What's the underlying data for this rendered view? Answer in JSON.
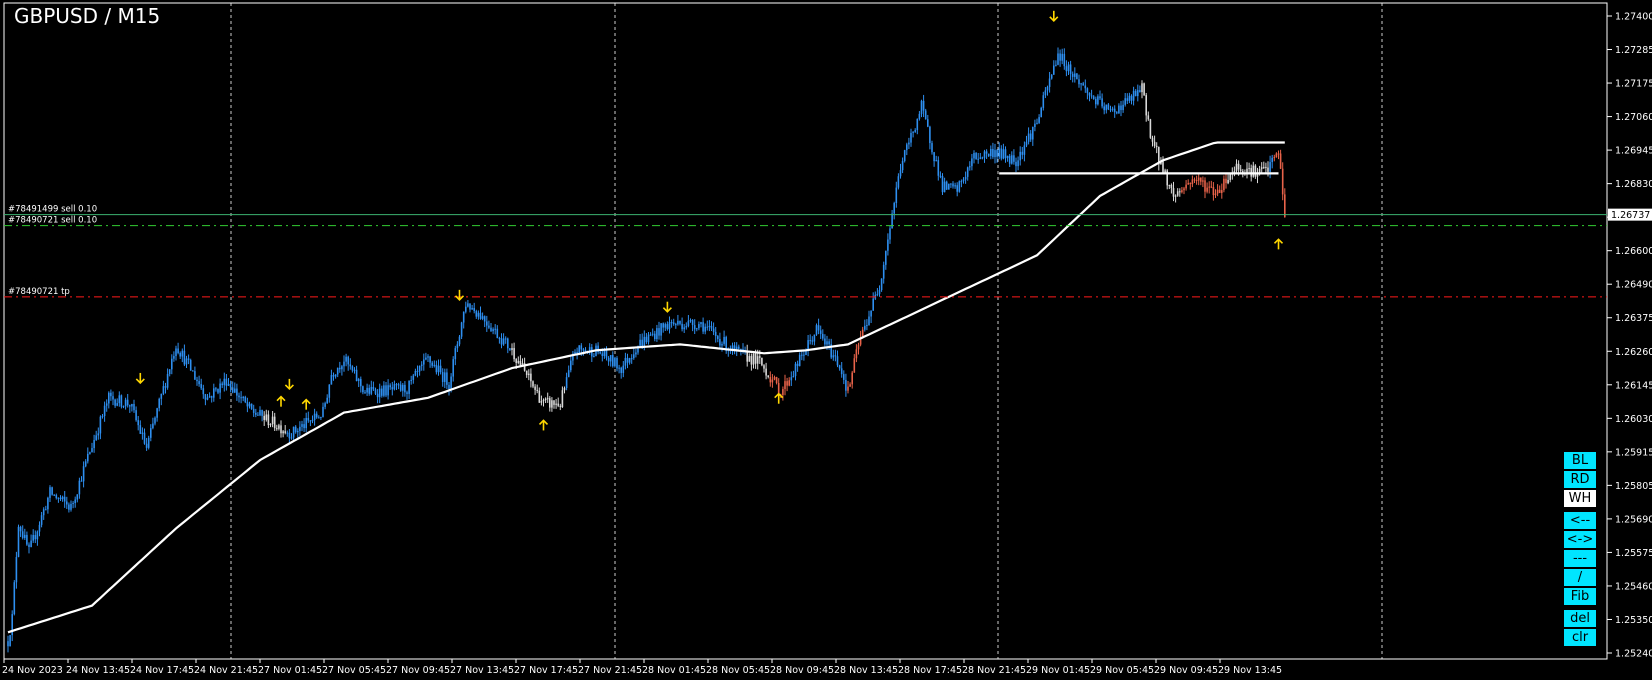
{
  "title": "GBPUSD / M15",
  "buttons": [
    {
      "label": "BL",
      "style": "cyan",
      "gap": false
    },
    {
      "label": "RD",
      "style": "cyan",
      "gap": false
    },
    {
      "label": "WH",
      "style": "white",
      "gap": false
    },
    {
      "label": "<--",
      "style": "cyan",
      "gap": true
    },
    {
      "label": "<->",
      "style": "cyan",
      "gap": false
    },
    {
      "label": "---",
      "style": "cyan",
      "gap": false
    },
    {
      "label": "/",
      "style": "cyan",
      "gap": false
    },
    {
      "label": "Fib",
      "style": "cyan",
      "gap": false
    },
    {
      "label": "del",
      "style": "cyan",
      "gap": true
    },
    {
      "label": "clr",
      "style": "cyan",
      "gap": false
    }
  ],
  "chart_data": {
    "type": "candlestick",
    "symbol": "GBPUSD",
    "timeframe": "M15",
    "ylim": [
      1.2524,
      1.2745
    ],
    "y_ticks": [
      "1.27400",
      "1.27285",
      "1.27175",
      "1.27060",
      "1.26945",
      "1.26830",
      "1.26715",
      "1.26600",
      "1.26490",
      "1.26375",
      "1.26260",
      "1.26145",
      "1.26030",
      "1.25915",
      "1.25805",
      "1.25690",
      "1.25575",
      "1.25460",
      "1.25350",
      "1.25240"
    ],
    "x_ticks": [
      "24 Nov 2023",
      "24 Nov 13:45",
      "24 Nov 17:45",
      "24 Nov 21:45",
      "27 Nov 01:45",
      "27 Nov 05:45",
      "27 Nov 09:45",
      "27 Nov 13:45",
      "27 Nov 17:45",
      "27 Nov 21:45",
      "28 Nov 01:45",
      "28 Nov 05:45",
      "28 Nov 09:45",
      "28 Nov 13:45",
      "28 Nov 17:45",
      "28 Nov 21:45",
      "29 Nov 01:45",
      "29 Nov 05:45",
      "29 Nov 09:45",
      "29 Nov 13:45"
    ],
    "grid": "vertical-dotted",
    "current_price": "1.26737",
    "price_key_points": [
      [
        0,
        1.253
      ],
      [
        2,
        1.2538
      ],
      [
        5,
        1.257
      ],
      [
        10,
        1.256
      ],
      [
        20,
        1.258
      ],
      [
        30,
        1.2575
      ],
      [
        38,
        1.2592
      ],
      [
        48,
        1.2612
      ],
      [
        58,
        1.261
      ],
      [
        66,
        1.2595
      ],
      [
        80,
        1.263
      ],
      [
        95,
        1.2612
      ],
      [
        104,
        1.2618
      ],
      [
        115,
        1.2608
      ],
      [
        135,
        1.26
      ],
      [
        150,
        1.2607
      ],
      [
        154,
        1.262
      ],
      [
        160,
        1.2625
      ],
      [
        170,
        1.2614
      ],
      [
        190,
        1.2615
      ],
      [
        200,
        1.2625
      ],
      [
        210,
        1.2617
      ],
      [
        218,
        1.2644
      ],
      [
        225,
        1.264
      ],
      [
        240,
        1.2628
      ],
      [
        255,
        1.261
      ],
      [
        263,
        1.261
      ],
      [
        270,
        1.2628
      ],
      [
        280,
        1.2628
      ],
      [
        292,
        1.2622
      ],
      [
        300,
        1.263
      ],
      [
        315,
        1.2637
      ],
      [
        330,
        1.2637
      ],
      [
        345,
        1.2628
      ],
      [
        358,
        1.2624
      ],
      [
        368,
        1.2614
      ],
      [
        375,
        1.2622
      ],
      [
        385,
        1.2635
      ],
      [
        396,
        1.2623
      ],
      [
        400,
        1.2614
      ],
      [
        405,
        1.263
      ],
      [
        415,
        1.265
      ],
      [
        425,
        1.269
      ],
      [
        435,
        1.271
      ],
      [
        445,
        1.2683
      ],
      [
        452,
        1.2682
      ],
      [
        460,
        1.2693
      ],
      [
        470,
        1.2695
      ],
      [
        480,
        1.2692
      ],
      [
        490,
        1.2705
      ],
      [
        500,
        1.2728
      ],
      [
        505,
        1.2723
      ],
      [
        515,
        1.2714
      ],
      [
        525,
        1.2708
      ],
      [
        535,
        1.2713
      ],
      [
        540,
        1.2716
      ],
      [
        545,
        1.2698
      ],
      [
        555,
        1.268
      ],
      [
        565,
        1.2686
      ],
      [
        575,
        1.2681
      ],
      [
        585,
        1.269
      ],
      [
        595,
        1.2688
      ],
      [
        600,
        1.2689
      ],
      [
        605,
        1.2695
      ],
      [
        608,
        1.2674
      ]
    ],
    "moving_average_key_points": [
      [
        0,
        1.2533
      ],
      [
        40,
        1.2542
      ],
      [
        80,
        1.2568
      ],
      [
        120,
        1.2591
      ],
      [
        160,
        1.2607
      ],
      [
        200,
        1.2612
      ],
      [
        240,
        1.2622
      ],
      [
        280,
        1.2628
      ],
      [
        320,
        1.263
      ],
      [
        360,
        1.2627
      ],
      [
        380,
        1.2628
      ],
      [
        400,
        1.263
      ],
      [
        430,
        1.264
      ],
      [
        460,
        1.265
      ],
      [
        490,
        1.266
      ],
      [
        520,
        1.268
      ],
      [
        550,
        1.2692
      ],
      [
        575,
        1.2698
      ],
      [
        595,
        1.2698
      ],
      [
        608,
        1.2698
      ]
    ],
    "colored_segments": [
      {
        "from": 122,
        "to": 132,
        "color": "#d9d9d9"
      },
      {
        "from": 240,
        "to": 265,
        "color": "#d9d9d9"
      },
      {
        "from": 352,
        "to": 362,
        "color": "#d9d9d9"
      },
      {
        "from": 362,
        "to": 372,
        "color": "#e8634a"
      },
      {
        "from": 400,
        "to": 407,
        "color": "#e8634a"
      },
      {
        "from": 540,
        "to": 558,
        "color": "#d9d9d9"
      },
      {
        "from": 558,
        "to": 580,
        "color": "#e8634a"
      },
      {
        "from": 580,
        "to": 600,
        "color": "#d9d9d9"
      },
      {
        "from": 603,
        "to": 608,
        "color": "#e8634a"
      }
    ],
    "up_arrows": [
      [
        130,
        1.2609
      ],
      [
        142,
        1.2608
      ],
      [
        255,
        1.2601
      ],
      [
        367,
        1.261
      ],
      [
        605,
        1.2662
      ]
    ],
    "down_arrows": [
      [
        63,
        1.2617
      ],
      [
        134,
        1.2615
      ],
      [
        215,
        1.2645
      ],
      [
        314,
        1.2641
      ],
      [
        498,
        1.2739
      ]
    ],
    "support_line": {
      "from": 472,
      "to": 605,
      "price": 1.26876
    },
    "orders": [
      {
        "label": "#78491499 sell 0.10",
        "price": 1.26737,
        "color": "#3cb371",
        "style": "solid"
      },
      {
        "label": "#78490721 sell 0.10",
        "price": 1.267,
        "color": "#32cd32",
        "style": "dashdot"
      },
      {
        "label": "#78490721 tp",
        "price": 1.2646,
        "color": "#ff1a1a",
        "style": "dashdot"
      }
    ],
    "colors": {
      "bull": "#2e8ff0",
      "bear": "#e8634a",
      "neutral": "#d9d9d9",
      "ma": "#ffffff",
      "arrow": "#ffd700"
    }
  }
}
